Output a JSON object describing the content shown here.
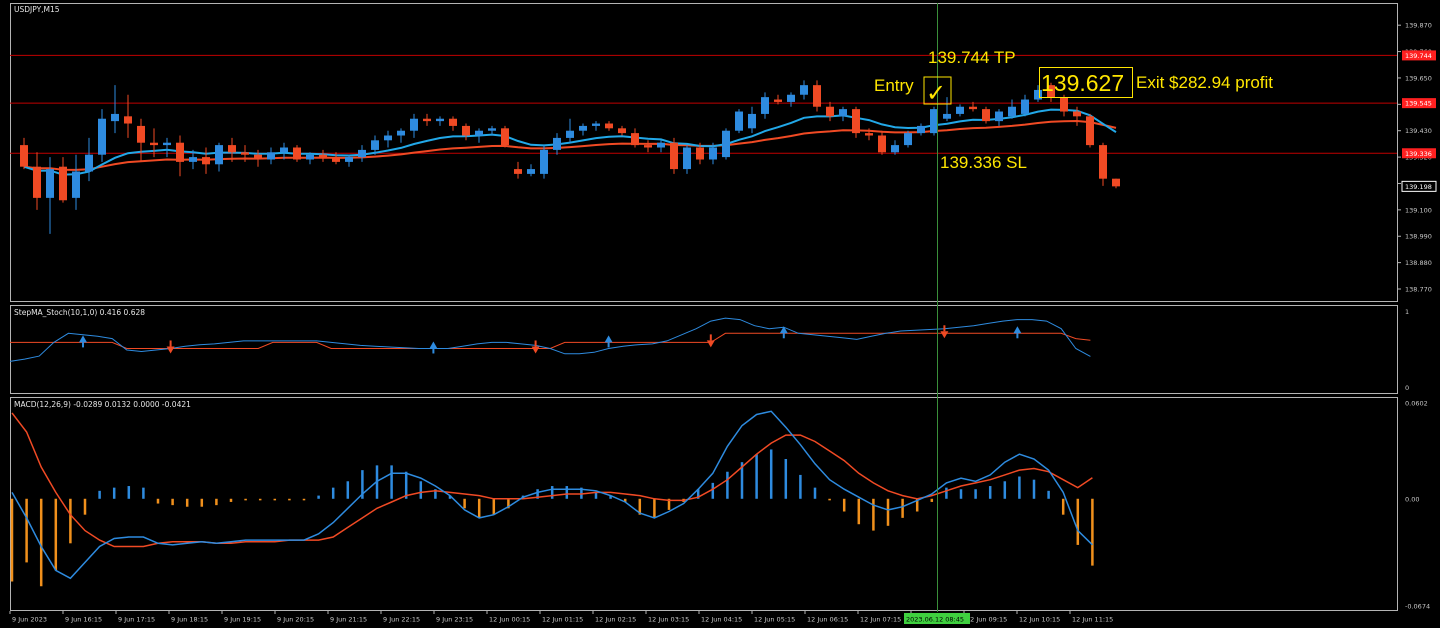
{
  "window": {
    "symbol_title": "USDJPY,M15"
  },
  "chart_data": [
    {
      "type": "candlestick",
      "title": "USDJPY,M15",
      "ylim": [
        138.72,
        139.95
      ],
      "y_ticks": [
        "139.870",
        "139.760",
        "139.650",
        "139.540",
        "139.430",
        "139.320",
        "139.210",
        "139.100",
        "138.990",
        "138.880",
        "138.770"
      ],
      "price_tags": [
        {
          "text": "139.744",
          "price": 139.744,
          "color": "#ff2020"
        },
        {
          "text": "139.545",
          "price": 139.545,
          "color": "#ff2020"
        },
        {
          "text": "139.336",
          "price": 139.336,
          "color": "#ff2020"
        },
        {
          "text": "139.198",
          "price": 139.198,
          "color": "#ffffff"
        }
      ],
      "horizontal_lines": [
        {
          "name": "take-profit",
          "price": 139.744,
          "color": "#c00000"
        },
        {
          "name": "entry",
          "price": 139.545,
          "color": "#c00000"
        },
        {
          "name": "stop-loss",
          "price": 139.336,
          "color": "#c00000"
        }
      ],
      "bull_color": "#2e8bdf",
      "bear_color": "#f04a24",
      "candles": [
        [
          139.37,
          139.4,
          139.27,
          139.28
        ],
        [
          139.28,
          139.34,
          139.1,
          139.15
        ],
        [
          139.15,
          139.32,
          139.0,
          139.27
        ],
        [
          139.28,
          139.32,
          139.13,
          139.14
        ],
        [
          139.15,
          139.33,
          139.1,
          139.26
        ],
        [
          139.26,
          139.4,
          139.22,
          139.33
        ],
        [
          139.33,
          139.52,
          139.3,
          139.48
        ],
        [
          139.47,
          139.62,
          139.42,
          139.5
        ],
        [
          139.49,
          139.58,
          139.4,
          139.46
        ],
        [
          139.45,
          139.48,
          139.3,
          139.38
        ],
        [
          139.38,
          139.44,
          139.32,
          139.37
        ],
        [
          139.37,
          139.4,
          139.32,
          139.38
        ],
        [
          139.38,
          139.41,
          139.24,
          139.3
        ],
        [
          139.3,
          139.35,
          139.27,
          139.32
        ],
        [
          139.32,
          139.36,
          139.25,
          139.29
        ],
        [
          139.29,
          139.38,
          139.26,
          139.37
        ],
        [
          139.37,
          139.4,
          139.3,
          139.34
        ],
        [
          139.34,
          139.37,
          139.3,
          139.33
        ],
        [
          139.33,
          139.35,
          139.28,
          139.31
        ],
        [
          139.31,
          139.36,
          139.29,
          139.34
        ],
        [
          139.34,
          139.38,
          139.31,
          139.36
        ],
        [
          139.36,
          139.37,
          139.3,
          139.31
        ],
        [
          139.31,
          139.34,
          139.29,
          139.33
        ],
        [
          139.33,
          139.35,
          139.3,
          139.32
        ],
        [
          139.32,
          139.34,
          139.29,
          139.3
        ],
        [
          139.3,
          139.33,
          139.28,
          139.32
        ],
        [
          139.32,
          139.37,
          139.3,
          139.35
        ],
        [
          139.35,
          139.41,
          139.33,
          139.39
        ],
        [
          139.39,
          139.43,
          139.36,
          139.41
        ],
        [
          139.41,
          139.44,
          139.38,
          139.43
        ],
        [
          139.43,
          139.5,
          139.4,
          139.48
        ],
        [
          139.48,
          139.5,
          139.45,
          139.47
        ],
        [
          139.47,
          139.49,
          139.45,
          139.48
        ],
        [
          139.48,
          139.49,
          139.43,
          139.45
        ],
        [
          139.45,
          139.46,
          139.39,
          139.41
        ],
        [
          139.41,
          139.44,
          139.38,
          139.43
        ],
        [
          139.43,
          139.45,
          139.41,
          139.44
        ],
        [
          139.44,
          139.45,
          139.36,
          139.37
        ],
        [
          139.27,
          139.3,
          139.23,
          139.25
        ],
        [
          139.25,
          139.29,
          139.24,
          139.27
        ],
        [
          139.25,
          139.37,
          139.23,
          139.35
        ],
        [
          139.35,
          139.42,
          139.33,
          139.4
        ],
        [
          139.4,
          139.48,
          139.38,
          139.43
        ],
        [
          139.43,
          139.46,
          139.41,
          139.45
        ],
        [
          139.45,
          139.47,
          139.43,
          139.46
        ],
        [
          139.46,
          139.47,
          139.43,
          139.44
        ],
        [
          139.44,
          139.45,
          139.41,
          139.42
        ],
        [
          139.42,
          139.44,
          139.36,
          139.37
        ],
        [
          139.37,
          139.39,
          139.34,
          139.36
        ],
        [
          139.36,
          139.39,
          139.34,
          139.38
        ],
        [
          139.38,
          139.4,
          139.25,
          139.27
        ],
        [
          139.27,
          139.37,
          139.25,
          139.36
        ],
        [
          139.36,
          139.38,
          139.29,
          139.31
        ],
        [
          139.31,
          139.38,
          139.29,
          139.36
        ],
        [
          139.32,
          139.44,
          139.31,
          139.43
        ],
        [
          139.43,
          139.52,
          139.42,
          139.51
        ],
        [
          139.44,
          139.53,
          139.42,
          139.5
        ],
        [
          139.5,
          139.59,
          139.48,
          139.57
        ],
        [
          139.56,
          139.58,
          139.54,
          139.55
        ],
        [
          139.55,
          139.59,
          139.53,
          139.58
        ],
        [
          139.58,
          139.64,
          139.56,
          139.62
        ],
        [
          139.62,
          139.64,
          139.51,
          139.53
        ],
        [
          139.53,
          139.55,
          139.47,
          139.49
        ],
        [
          139.49,
          139.53,
          139.47,
          139.52
        ],
        [
          139.52,
          139.53,
          139.4,
          139.42
        ],
        [
          139.42,
          139.44,
          139.39,
          139.41
        ],
        [
          139.41,
          139.43,
          139.33,
          139.34
        ],
        [
          139.34,
          139.39,
          139.33,
          139.37
        ],
        [
          139.37,
          139.43,
          139.36,
          139.42
        ],
        [
          139.42,
          139.46,
          139.41,
          139.45
        ],
        [
          139.42,
          139.53,
          139.41,
          139.52
        ],
        [
          139.48,
          139.57,
          139.47,
          139.5
        ],
        [
          139.5,
          139.54,
          139.49,
          139.53
        ],
        [
          139.53,
          139.55,
          139.51,
          139.52
        ],
        [
          139.52,
          139.53,
          139.46,
          139.47
        ],
        [
          139.47,
          139.52,
          139.45,
          139.51
        ],
        [
          139.49,
          139.56,
          139.48,
          139.53
        ],
        [
          139.5,
          139.58,
          139.49,
          139.56
        ],
        [
          139.56,
          139.62,
          139.55,
          139.6
        ],
        [
          139.62,
          139.63,
          139.55,
          139.57
        ],
        [
          139.57,
          139.58,
          139.49,
          139.51
        ],
        [
          139.51,
          139.53,
          139.45,
          139.49
        ],
        [
          139.49,
          139.5,
          139.36,
          139.37
        ],
        [
          139.37,
          139.38,
          139.2,
          139.23
        ],
        [
          139.23,
          139.23,
          139.19,
          139.198
        ]
      ]
    },
    {
      "type": "line",
      "title": "StepMA_Stoch(10,1,0) 0.416 0.628",
      "ylim": [
        0,
        1
      ],
      "y_ticks": [
        "1",
        "0"
      ],
      "series": [
        {
          "color": "#2e8bdf",
          "values": [
            0.35,
            0.38,
            0.42,
            0.6,
            0.72,
            0.7,
            0.68,
            0.65,
            0.5,
            0.48,
            0.5,
            0.52,
            0.55,
            0.57,
            0.58,
            0.6,
            0.62,
            0.62,
            0.62,
            0.62,
            0.62,
            0.62,
            0.6,
            0.58,
            0.56,
            0.55,
            0.54,
            0.53,
            0.52,
            0.52,
            0.52,
            0.55,
            0.58,
            0.6,
            0.6,
            0.58,
            0.56,
            0.52,
            0.45,
            0.45,
            0.47,
            0.52,
            0.55,
            0.57,
            0.58,
            0.62,
            0.7,
            0.78,
            0.88,
            0.92,
            0.9,
            0.82,
            0.78,
            0.8,
            0.72,
            0.7,
            0.68,
            0.66,
            0.64,
            0.68,
            0.72,
            0.75,
            0.76,
            0.77,
            0.78,
            0.8,
            0.82,
            0.85,
            0.88,
            0.9,
            0.9,
            0.88,
            0.78,
            0.52,
            0.416
          ]
        },
        {
          "color": "#f04a24",
          "values": [
            0.6,
            0.6,
            0.6,
            0.6,
            0.6,
            0.6,
            0.6,
            0.6,
            0.52,
            0.52,
            0.52,
            0.52,
            0.52,
            0.52,
            0.52,
            0.52,
            0.52,
            0.52,
            0.6,
            0.6,
            0.6,
            0.6,
            0.52,
            0.52,
            0.52,
            0.52,
            0.52,
            0.52,
            0.52,
            0.52,
            0.52,
            0.52,
            0.52,
            0.52,
            0.52,
            0.52,
            0.52,
            0.52,
            0.6,
            0.6,
            0.6,
            0.6,
            0.6,
            0.6,
            0.6,
            0.6,
            0.6,
            0.6,
            0.6,
            0.72,
            0.72,
            0.72,
            0.72,
            0.72,
            0.72,
            0.72,
            0.72,
            0.72,
            0.72,
            0.72,
            0.72,
            0.72,
            0.72,
            0.72,
            0.72,
            0.72,
            0.72,
            0.72,
            0.72,
            0.72,
            0.72,
            0.72,
            0.72,
            0.65,
            0.628
          ]
        }
      ],
      "arrows": [
        {
          "index": 5,
          "direction": "up",
          "color": "#2e8bdf"
        },
        {
          "index": 11,
          "direction": "down",
          "color": "#f04a24"
        },
        {
          "index": 29,
          "direction": "up",
          "color": "#2e8bdf"
        },
        {
          "index": 36,
          "direction": "down",
          "color": "#f04a24"
        },
        {
          "index": 41,
          "direction": "up",
          "color": "#2e8bdf"
        },
        {
          "index": 48,
          "direction": "down",
          "color": "#f04a24"
        },
        {
          "index": 53,
          "direction": "up",
          "color": "#2e8bdf"
        },
        {
          "index": 64,
          "direction": "down",
          "color": "#f04a24"
        },
        {
          "index": 69,
          "direction": "up",
          "color": "#2e8bdf"
        },
        {
          "index": 82,
          "direction": "down",
          "color": "#f04a24"
        }
      ]
    },
    {
      "type": "bar",
      "title": "MACD(12,26,9) -0.0289 0.0132 0.0000 -0.0421",
      "ylim": [
        -0.0674,
        0.0602
      ],
      "y_ticks": [
        "0.0602",
        "0.00",
        "-0.0674"
      ],
      "series": [
        {
          "name": "histogram",
          "values": [
            -0.052,
            -0.04,
            -0.055,
            -0.045,
            -0.028,
            -0.01,
            0.005,
            0.007,
            0.008,
            0.007,
            -0.003,
            -0.004,
            -0.005,
            -0.005,
            -0.004,
            -0.002,
            -0.001,
            -0.001,
            -0.001,
            -0.001,
            -0.001,
            0.002,
            0.007,
            0.011,
            0.018,
            0.021,
            0.021,
            0.017,
            0.011,
            0.006,
            0.002,
            -0.006,
            -0.012,
            -0.01,
            -0.006,
            0.002,
            0.006,
            0.008,
            0.008,
            0.007,
            0.004,
            0.002,
            -0.002,
            -0.01,
            -0.012,
            -0.007,
            -0.002,
            0.006,
            0.01,
            0.017,
            0.023,
            0.028,
            0.031,
            0.025,
            0.015,
            0.007,
            -0.001,
            -0.008,
            -0.016,
            -0.02,
            -0.017,
            -0.012,
            -0.008,
            -0.002,
            0.007,
            0.006,
            0.006,
            0.008,
            0.011,
            0.014,
            0.012,
            0.005,
            -0.01,
            -0.029,
            -0.042
          ]
        },
        {
          "name": "macd",
          "color": "#2e8bdf",
          "values": [
            0.004,
            -0.012,
            -0.03,
            -0.045,
            -0.05,
            -0.04,
            -0.03,
            -0.025,
            -0.024,
            -0.024,
            -0.028,
            -0.029,
            -0.028,
            -0.027,
            -0.028,
            -0.027,
            -0.026,
            -0.026,
            -0.026,
            -0.026,
            -0.026,
            -0.022,
            -0.015,
            -0.006,
            0.003,
            0.011,
            0.016,
            0.016,
            0.013,
            0.008,
            0.002,
            -0.007,
            -0.012,
            -0.01,
            -0.005,
            0.001,
            0.004,
            0.006,
            0.006,
            0.006,
            0.005,
            0.002,
            -0.002,
            -0.009,
            -0.012,
            -0.008,
            -0.003,
            0.006,
            0.016,
            0.033,
            0.046,
            0.053,
            0.055,
            0.045,
            0.034,
            0.022,
            0.012,
            0.006,
            0.001,
            -0.004,
            -0.007,
            -0.005,
            -0.001,
            0.003,
            0.01,
            0.013,
            0.011,
            0.015,
            0.023,
            0.028,
            0.025,
            0.018,
            0.004,
            -0.02,
            -0.0289
          ]
        },
        {
          "name": "signal",
          "color": "#f04a24",
          "values": [
            0.054,
            0.042,
            0.02,
            0.004,
            -0.01,
            -0.02,
            -0.026,
            -0.03,
            -0.03,
            -0.03,
            -0.028,
            -0.027,
            -0.027,
            -0.027,
            -0.028,
            -0.028,
            -0.027,
            -0.027,
            -0.027,
            -0.026,
            -0.026,
            -0.026,
            -0.024,
            -0.018,
            -0.012,
            -0.006,
            -0.002,
            0.002,
            0.004,
            0.005,
            0.004,
            0.003,
            0.002,
            0.0,
            0.0,
            0.0,
            0.001,
            0.002,
            0.003,
            0.003,
            0.004,
            0.004,
            0.003,
            0.002,
            0.0,
            -0.001,
            -0.001,
            0.001,
            0.006,
            0.012,
            0.02,
            0.028,
            0.035,
            0.04,
            0.04,
            0.036,
            0.03,
            0.024,
            0.016,
            0.01,
            0.005,
            0.002,
            0.0,
            0.002,
            0.005,
            0.008,
            0.01,
            0.012,
            0.015,
            0.018,
            0.019,
            0.017,
            0.012,
            0.007,
            0.0132
          ]
        }
      ]
    }
  ],
  "x_axis": {
    "ticks": [
      "9 Jun 2023",
      "9 Jun 16:15",
      "9 Jun 17:15",
      "9 Jun 18:15",
      "9 Jun 19:15",
      "9 Jun 20:15",
      "9 Jun 21:15",
      "9 Jun 22:15",
      "9 Jun 23:15",
      "12 Jun 00:15",
      "12 Jun 01:15",
      "12 Jun 02:15",
      "12 Jun 03:15",
      "12 Jun 04:15",
      "12 Jun 05:15",
      "12 Jun 06:15",
      "12 Jun 07:15",
      "12 Jun 08:15",
      "12 Jun 09:15",
      "12 Jun 10:15",
      "12 Jun 11:15"
    ],
    "cursor_label": "2023.06.12 08:45"
  },
  "annotations": {
    "tp_label": "139.744 TP",
    "sl_label": "139.336 SL",
    "entry_label": "Entry",
    "check_mark": "✓",
    "exit_price": "139.627",
    "exit_text": "Exit $282.94 profit"
  },
  "colors": {
    "background": "#000000",
    "grid_border": "#b4b4b4",
    "level_line": "#c00000",
    "ma_fast": "#22a8e8",
    "ma_slow": "#f04a24",
    "cursor_line": "#3a8f3a",
    "annotation": "#ffe600"
  }
}
